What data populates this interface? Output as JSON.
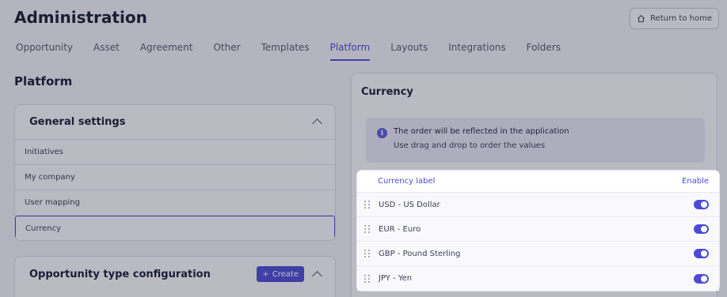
{
  "header": {
    "title": "Administration",
    "return_label": "Return to home",
    "tabs": [
      {
        "label": "Opportunity"
      },
      {
        "label": "Asset"
      },
      {
        "label": "Agreement"
      },
      {
        "label": "Other"
      },
      {
        "label": "Templates"
      },
      {
        "label": "Platform",
        "active": true
      },
      {
        "label": "Layouts"
      },
      {
        "label": "Integrations"
      },
      {
        "label": "Folders"
      }
    ]
  },
  "left": {
    "title": "Platform",
    "general": {
      "title": "General settings",
      "items": [
        "Initiatives",
        "My company",
        "User mapping",
        "Currency"
      ]
    },
    "opportunity": {
      "title": "Opportunity type configuration",
      "create_label": "Create"
    }
  },
  "currency": {
    "title": "Currency",
    "info_line1": "The order will be reflected in the application",
    "info_line2": "Use drag and drop to order the values",
    "col_label": "Currency label",
    "col_enable": "Enable",
    "rows": [
      {
        "label": "USD - US Dollar",
        "enabled": true
      },
      {
        "label": "EUR - Euro",
        "enabled": true
      },
      {
        "label": "GBP - Pound Sterling",
        "enabled": true
      },
      {
        "label": "JPY - Yen",
        "enabled": true
      }
    ]
  },
  "colors": {
    "accent": "#4b4bd6",
    "overlay": "rgba(35,38,60,0.30)"
  },
  "icons": {
    "return": "home-icon",
    "info": "info-icon",
    "drag": "drag-handle-icon",
    "collapse": "chevron-up-icon",
    "create": "plus-icon"
  }
}
